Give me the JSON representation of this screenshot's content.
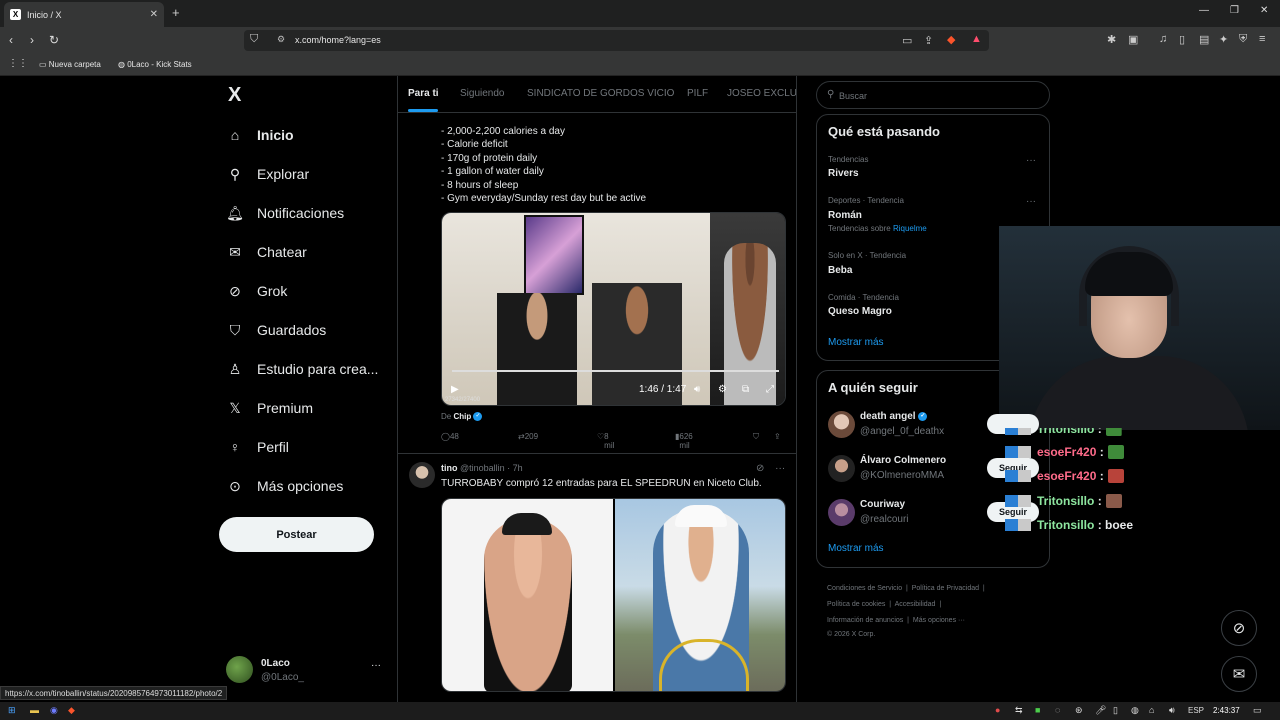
{
  "browser": {
    "tab_title": "Inicio / X",
    "tab_favicon": "X",
    "new_tab": "+",
    "url": "x.com/home?lang=es",
    "bookmarks": [
      "Nueva carpeta",
      "0Laco - Kick Stats"
    ],
    "status_url": "https://x.com/tinoballin/status/2020985764973011182/photo/2"
  },
  "nav": {
    "logo": "X",
    "items": [
      {
        "label": "Inicio",
        "icon": "home-icon"
      },
      {
        "label": "Explorar",
        "icon": "search-icon"
      },
      {
        "label": "Notificaciones",
        "icon": "bell-icon"
      },
      {
        "label": "Chatear",
        "icon": "mail-icon"
      },
      {
        "label": "Grok",
        "icon": "grok-icon"
      },
      {
        "label": "Guardados",
        "icon": "bookmark-icon"
      },
      {
        "label": "Estudio para crea...",
        "icon": "studio-icon"
      },
      {
        "label": "Premium",
        "icon": "x-premium-icon"
      },
      {
        "label": "Perfil",
        "icon": "person-icon"
      },
      {
        "label": "Más opciones",
        "icon": "more-circle-icon"
      }
    ],
    "post_button": "Postear",
    "account": {
      "name": "0Laco",
      "handle": "@0Laco_",
      "more": "···"
    }
  },
  "feed": {
    "tabs": [
      "Para ti",
      "Siguiendo",
      "SINDICATO DE GORDOS VICIO",
      "PILF",
      "JOSEO EXCLUSI"
    ],
    "tweet1": {
      "lines": [
        "- 2,000-2,200 calories a day",
        "- Calorie deficit",
        "- 170g of protein daily",
        "- 1 gallon of water daily",
        "- 8 hours of sleep",
        "- Gym everyday/Sunday rest day but be active"
      ],
      "video_time": "1:46 / 1:47",
      "video_watermark": "27342/27400",
      "credit_prefix": "De",
      "credit_name": "Chip",
      "replies": "48",
      "reposts": "209",
      "likes": "8 mil",
      "views": "626 mil"
    },
    "tweet2": {
      "name": "tino",
      "handle_time": "@tinoballin · 7h",
      "text": "TURROBABY compró 12 entradas para EL SPEEDRUN en Niceto Club."
    }
  },
  "right": {
    "search_placeholder": "Buscar",
    "trends_title": "Qué está pasando",
    "trends": [
      {
        "meta": "Tendencias",
        "name": "Rivers"
      },
      {
        "meta": "Deportes · Tendencia",
        "name": "Román",
        "extra_prefix": "Tendencias sobre",
        "extra_link": "Riquelme"
      },
      {
        "meta": "Solo en X · Tendencia",
        "name": "Beba"
      },
      {
        "meta": "Comida · Tendencia",
        "name": "Queso Magro"
      }
    ],
    "trends_more": "Mostrar más",
    "who_title": "A quién seguir",
    "who": [
      {
        "name": "death angel",
        "handle": "@angel_0f_deathx"
      },
      {
        "name": "Álvaro Colmenero",
        "handle": "@KOlmeneroMMA"
      },
      {
        "name": "Couriway",
        "handle": "@realcouri"
      }
    ],
    "who_more": "Mostrar más",
    "follow_label": "Seguir",
    "footer": [
      "Condiciones de Servicio",
      "Política de Privacidad",
      "Política de cookies",
      "Accesibilidad",
      "Información de anuncios",
      "Más opciones ···",
      "© 2026 X Corp."
    ]
  },
  "chat": [
    {
      "user": "Tritonsillo",
      "msg": ":",
      "color": "#8ee6a0"
    },
    {
      "user": "esoeFr420",
      "msg": ":",
      "color": "#ff6b8a"
    },
    {
      "user": "esoeFr420",
      "msg": ":",
      "color": "#ff6b8a"
    },
    {
      "user": "Tritonsillo",
      "msg": ":",
      "color": "#8ee6a0"
    },
    {
      "user": "Tritonsillo",
      "msg": ": boee",
      "color": "#8ee6a0"
    }
  ],
  "taskbar": {
    "lang": "ESP",
    "time": "2:43:37"
  }
}
